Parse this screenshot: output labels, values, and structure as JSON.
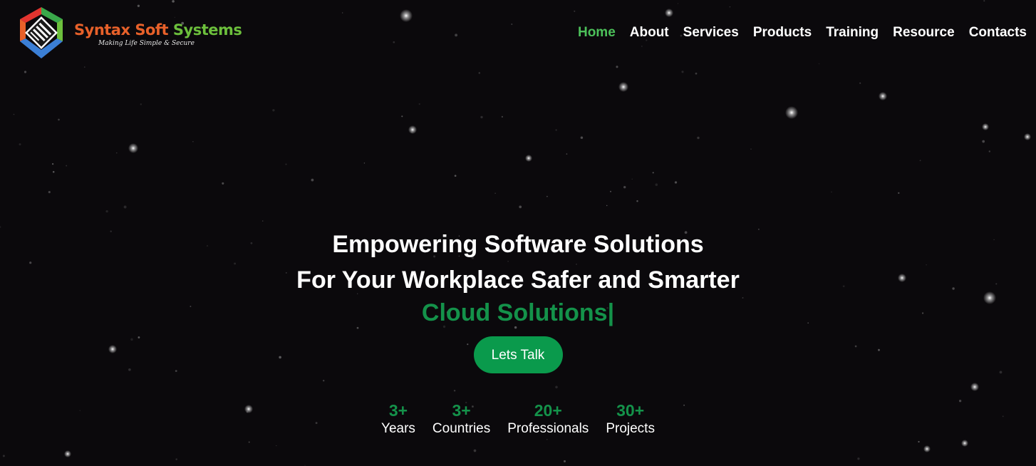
{
  "brand": {
    "name_part1": "Syntax",
    "name_part2": "Soft",
    "name_part3": "Systems",
    "tagline": "Making Life Simple & Secure",
    "colors": {
      "orange": "#e8612a",
      "green": "#6cbf3c",
      "blue": "#3b7fd6",
      "red": "#e3342f"
    }
  },
  "nav": {
    "items": [
      {
        "label": "Home",
        "active": true
      },
      {
        "label": "About",
        "active": false
      },
      {
        "label": "Services",
        "active": false
      },
      {
        "label": "Products",
        "active": false
      },
      {
        "label": "Training",
        "active": false
      },
      {
        "label": "Resource",
        "active": false
      },
      {
        "label": "Contacts",
        "active": false
      }
    ],
    "active_color": "#4cc05a"
  },
  "hero": {
    "line1": "Empowering Software Solutions",
    "line2": "For Your Workplace Safer and Smarter",
    "rotating_text": "Cloud Solutions",
    "cursor": "|",
    "cta_label": "Lets Talk",
    "accent_color": "#14924a"
  },
  "stats": [
    {
      "value": "3+",
      "label": "Years"
    },
    {
      "value": "3+",
      "label": "Countries"
    },
    {
      "value": "20+",
      "label": "Professionals"
    },
    {
      "value": "30+",
      "label": "Projects"
    }
  ],
  "background": {
    "color": "#0b090c"
  }
}
